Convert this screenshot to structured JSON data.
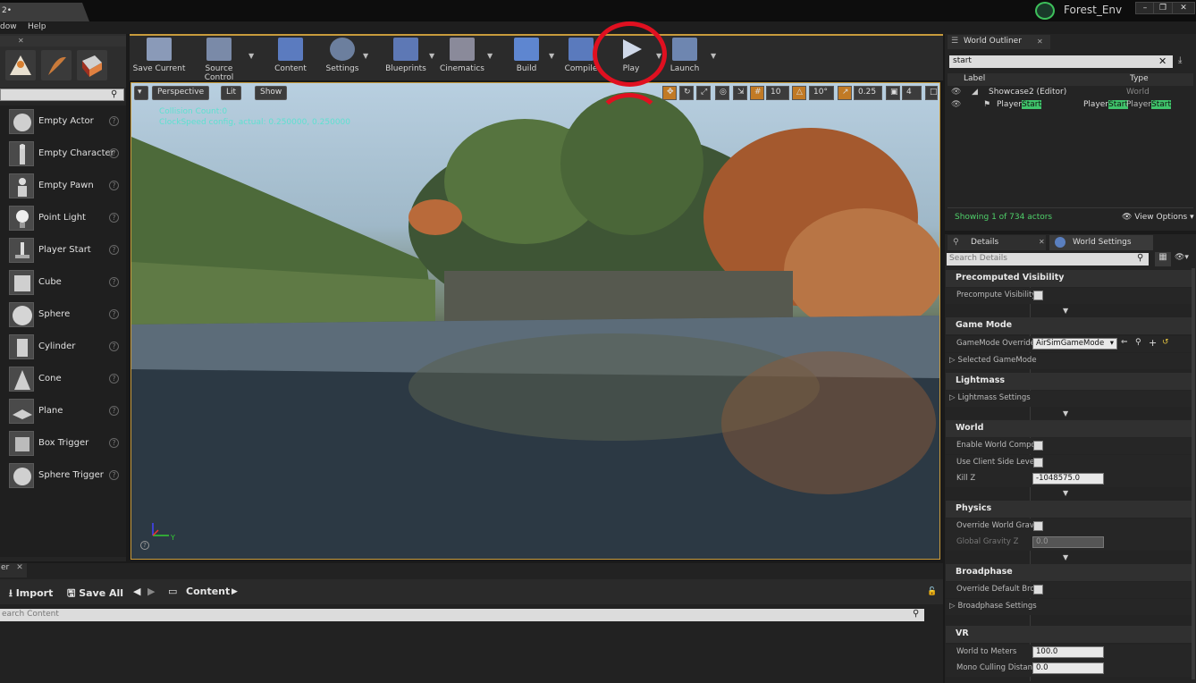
{
  "titlebar": {
    "doc_tab": "2•",
    "project": "Forest_Env"
  },
  "menubar": {
    "items": [
      "dow",
      "Help"
    ]
  },
  "place_list": {
    "items": [
      "Empty Actor",
      "Empty Character",
      "Empty Pawn",
      "Point Light",
      "Player Start",
      "Cube",
      "Sphere",
      "Cylinder",
      "Cone",
      "Plane",
      "Box Trigger",
      "Sphere Trigger"
    ]
  },
  "toolbar": {
    "save_current": "Save Current",
    "source_control": "Source Control",
    "content": "Content",
    "settings": "Settings",
    "blueprints": "Blueprints",
    "cinematics": "Cinematics",
    "build": "Build",
    "compile": "Compile",
    "play": "Play",
    "launch": "Launch"
  },
  "viewport": {
    "perspective": "Perspective",
    "lit": "Lit",
    "show": "Show",
    "grid_snap": "10",
    "rot_snap": "10°",
    "scale_snap": "0.25",
    "cam_speed": "4",
    "overlay1": "Collision Count:0",
    "overlay2": "ClockSpeed config, actual: 0.250000, 0.250000",
    "axis_y": "Y"
  },
  "content_browser": {
    "tab": "er",
    "import": "Import",
    "save_all": "Save All",
    "path": "Content",
    "search_placeholder": "earch Content"
  },
  "outliner": {
    "tab": "World Outliner",
    "search_value": "start",
    "col_label": "Label",
    "col_type": "Type",
    "rows": [
      {
        "label": "Showcase2 (Editor)",
        "type": "World"
      },
      {
        "label_prefix": "Player",
        "label_hl": "Start",
        "type_prefix1": "Player",
        "type_hl1": "Start",
        "type_prefix2": "Player",
        "type_hl2": "Start"
      }
    ],
    "status": "Showing 1 of 734 actors",
    "view_options": "View Options"
  },
  "details": {
    "tab_details": "Details",
    "tab_world_settings": "World Settings",
    "search_placeholder": "Search Details",
    "sections": {
      "precomputed_visibility": "Precomputed Visibility",
      "game_mode": "Game Mode",
      "lightmass": "Lightmass",
      "world": "World",
      "physics": "Physics",
      "broadphase": "Broadphase",
      "vr": "VR"
    },
    "props": {
      "precompute_visibility": "Precompute Visibility",
      "gamemode_override": "GameMode Override",
      "gamemode_value": "AirSimGameMode",
      "selected_gamemode": "Selected GameMode",
      "lightmass_settings": "Lightmass Settings",
      "enable_world_compos": "Enable World Compos",
      "use_client_side_level": "Use Client Side Level",
      "kill_z": "Kill Z",
      "kill_z_value": "-1048575.0",
      "override_world_gravity": "Override World Gravit",
      "global_gravity_z": "Global Gravity Z",
      "global_gravity_value": "0.0",
      "override_default_broad": "Override Default Broa",
      "broadphase_settings": "Broadphase Settings",
      "world_to_meters": "World to Meters",
      "world_to_meters_value": "100.0",
      "mono_culling": "Mono Culling Distanc",
      "mono_culling_value": "0.0"
    }
  }
}
